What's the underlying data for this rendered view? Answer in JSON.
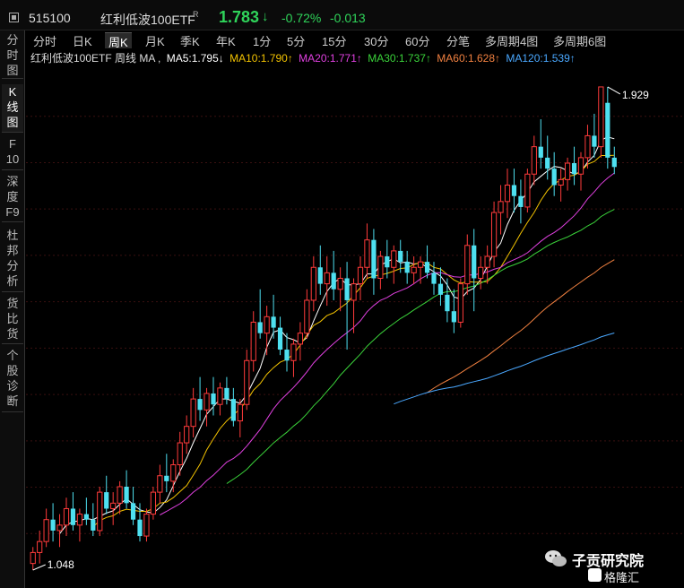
{
  "header": {
    "code": "515100",
    "name": "红利低波100ETF",
    "name_sup": "R",
    "price": "1.783",
    "arrow": "↓",
    "pct_change": "-0.72%",
    "abs_change": "-0.013",
    "up_color": "#ff3b3b",
    "down_color": "#2fd45a"
  },
  "left_tabs": [
    {
      "label": "分\n时\n图",
      "active": false
    },
    {
      "label": "K\n线\n图",
      "active": true
    },
    {
      "label": "F\n10",
      "active": false
    },
    {
      "label": "深\n度\nF9",
      "active": false
    },
    {
      "label": "杜\n邦\n分\n析",
      "active": false
    },
    {
      "label": "货\n比\n货",
      "active": false
    },
    {
      "label": "个\n股\n诊\n断",
      "active": false
    }
  ],
  "period_tabs": [
    {
      "label": "分时",
      "active": false
    },
    {
      "label": "日K",
      "active": false
    },
    {
      "label": "周K",
      "active": true
    },
    {
      "label": "月K",
      "active": false
    },
    {
      "label": "季K",
      "active": false
    },
    {
      "label": "年K",
      "active": false
    },
    {
      "label": "1分",
      "active": false
    },
    {
      "label": "5分",
      "active": false
    },
    {
      "label": "15分",
      "active": false
    },
    {
      "label": "30分",
      "active": false
    },
    {
      "label": "60分",
      "active": false
    },
    {
      "label": "分笔",
      "active": false
    },
    {
      "label": "多周期4图",
      "active": false
    },
    {
      "label": "多周期6图",
      "active": false
    }
  ],
  "ma_bar": {
    "prefix": "红利低波100ETF  周线  MA ,",
    "items": [
      {
        "text": "MA5:1.795↓",
        "color": "#ffffff"
      },
      {
        "text": "MA10:1.790↑",
        "color": "#f2c200"
      },
      {
        "text": "MA20:1.771↑",
        "color": "#e040e0"
      },
      {
        "text": "MA30:1.737↑",
        "color": "#3ad23a"
      },
      {
        "text": "MA60:1.628↑",
        "color": "#f08040"
      },
      {
        "text": "MA120:1.539↑",
        "color": "#4aa8ff"
      }
    ]
  },
  "chart_data": {
    "type": "candlestick",
    "period": "weekly",
    "high_label": "1.929",
    "low_label": "1.048",
    "y_range": [
      1.03,
      1.96
    ],
    "ohlc": [
      [
        1.06,
        1.09,
        1.048,
        1.08
      ],
      [
        1.08,
        1.12,
        1.06,
        1.1
      ],
      [
        1.1,
        1.16,
        1.09,
        1.14
      ],
      [
        1.14,
        1.17,
        1.1,
        1.12
      ],
      [
        1.12,
        1.15,
        1.09,
        1.13
      ],
      [
        1.13,
        1.18,
        1.11,
        1.16
      ],
      [
        1.16,
        1.19,
        1.12,
        1.13
      ],
      [
        1.13,
        1.16,
        1.1,
        1.15
      ],
      [
        1.15,
        1.18,
        1.13,
        1.14
      ],
      [
        1.14,
        1.17,
        1.11,
        1.12
      ],
      [
        1.12,
        1.2,
        1.11,
        1.19
      ],
      [
        1.19,
        1.22,
        1.15,
        1.16
      ],
      [
        1.16,
        1.19,
        1.13,
        1.17
      ],
      [
        1.17,
        1.21,
        1.15,
        1.2
      ],
      [
        1.2,
        1.23,
        1.16,
        1.17
      ],
      [
        1.17,
        1.2,
        1.13,
        1.14
      ],
      [
        1.14,
        1.17,
        1.1,
        1.11
      ],
      [
        1.11,
        1.16,
        1.1,
        1.15
      ],
      [
        1.15,
        1.2,
        1.14,
        1.19
      ],
      [
        1.19,
        1.24,
        1.17,
        1.22
      ],
      [
        1.22,
        1.26,
        1.19,
        1.21
      ],
      [
        1.21,
        1.25,
        1.19,
        1.24
      ],
      [
        1.24,
        1.3,
        1.22,
        1.28
      ],
      [
        1.28,
        1.33,
        1.26,
        1.31
      ],
      [
        1.31,
        1.38,
        1.29,
        1.36
      ],
      [
        1.36,
        1.4,
        1.32,
        1.34
      ],
      [
        1.34,
        1.38,
        1.31,
        1.37
      ],
      [
        1.37,
        1.4,
        1.33,
        1.35
      ],
      [
        1.35,
        1.39,
        1.33,
        1.38
      ],
      [
        1.38,
        1.4,
        1.35,
        1.36
      ],
      [
        1.36,
        1.38,
        1.31,
        1.32
      ],
      [
        1.32,
        1.36,
        1.29,
        1.35
      ],
      [
        1.35,
        1.45,
        1.34,
        1.43
      ],
      [
        1.43,
        1.52,
        1.41,
        1.5
      ],
      [
        1.5,
        1.56,
        1.47,
        1.48
      ],
      [
        1.48,
        1.53,
        1.44,
        1.51
      ],
      [
        1.51,
        1.55,
        1.47,
        1.49
      ],
      [
        1.49,
        1.51,
        1.44,
        1.45
      ],
      [
        1.45,
        1.48,
        1.41,
        1.43
      ],
      [
        1.43,
        1.47,
        1.4,
        1.46
      ],
      [
        1.46,
        1.5,
        1.43,
        1.48
      ],
      [
        1.48,
        1.56,
        1.47,
        1.54
      ],
      [
        1.54,
        1.62,
        1.52,
        1.6
      ],
      [
        1.6,
        1.64,
        1.55,
        1.57
      ],
      [
        1.57,
        1.62,
        1.53,
        1.59
      ],
      [
        1.59,
        1.63,
        1.54,
        1.56
      ],
      [
        1.56,
        1.6,
        1.52,
        1.58
      ],
      [
        1.58,
        1.61,
        1.45,
        1.54
      ],
      [
        1.54,
        1.58,
        1.48,
        1.57
      ],
      [
        1.57,
        1.62,
        1.54,
        1.6
      ],
      [
        1.6,
        1.68,
        1.58,
        1.65
      ],
      [
        1.65,
        1.67,
        1.55,
        1.58
      ],
      [
        1.58,
        1.63,
        1.56,
        1.62
      ],
      [
        1.62,
        1.65,
        1.58,
        1.6
      ],
      [
        1.6,
        1.64,
        1.57,
        1.63
      ],
      [
        1.63,
        1.65,
        1.59,
        1.61
      ],
      [
        1.61,
        1.63,
        1.57,
        1.59
      ],
      [
        1.59,
        1.62,
        1.57,
        1.6
      ],
      [
        1.6,
        1.62,
        1.57,
        1.61
      ],
      [
        1.61,
        1.64,
        1.58,
        1.59
      ],
      [
        1.59,
        1.61,
        1.55,
        1.57
      ],
      [
        1.57,
        1.6,
        1.53,
        1.55
      ],
      [
        1.55,
        1.58,
        1.5,
        1.52
      ],
      [
        1.52,
        1.56,
        1.48,
        1.5
      ],
      [
        1.5,
        1.58,
        1.49,
        1.57
      ],
      [
        1.57,
        1.66,
        1.55,
        1.64
      ],
      [
        1.64,
        1.67,
        1.52,
        1.58
      ],
      [
        1.58,
        1.62,
        1.56,
        1.6
      ],
      [
        1.6,
        1.64,
        1.57,
        1.62
      ],
      [
        1.62,
        1.72,
        1.6,
        1.7
      ],
      [
        1.7,
        1.75,
        1.66,
        1.72
      ],
      [
        1.72,
        1.78,
        1.69,
        1.75
      ],
      [
        1.75,
        1.78,
        1.7,
        1.73
      ],
      [
        1.73,
        1.76,
        1.68,
        1.71
      ],
      [
        1.71,
        1.78,
        1.7,
        1.77
      ],
      [
        1.77,
        1.84,
        1.75,
        1.82
      ],
      [
        1.82,
        1.87,
        1.78,
        1.8
      ],
      [
        1.8,
        1.84,
        1.76,
        1.78
      ],
      [
        1.78,
        1.81,
        1.73,
        1.75
      ],
      [
        1.75,
        1.78,
        1.72,
        1.76
      ],
      [
        1.76,
        1.8,
        1.74,
        1.79
      ],
      [
        1.79,
        1.82,
        1.75,
        1.77
      ],
      [
        1.77,
        1.81,
        1.74,
        1.8
      ],
      [
        1.8,
        1.86,
        1.78,
        1.84
      ],
      [
        1.84,
        1.88,
        1.8,
        1.82
      ],
      [
        1.82,
        1.92,
        1.8,
        1.929
      ],
      [
        1.9,
        1.929,
        1.78,
        1.8
      ],
      [
        1.8,
        1.82,
        1.77,
        1.783
      ]
    ]
  },
  "watermark": {
    "title": "子贡研究院",
    "subtitle": "格隆汇"
  }
}
